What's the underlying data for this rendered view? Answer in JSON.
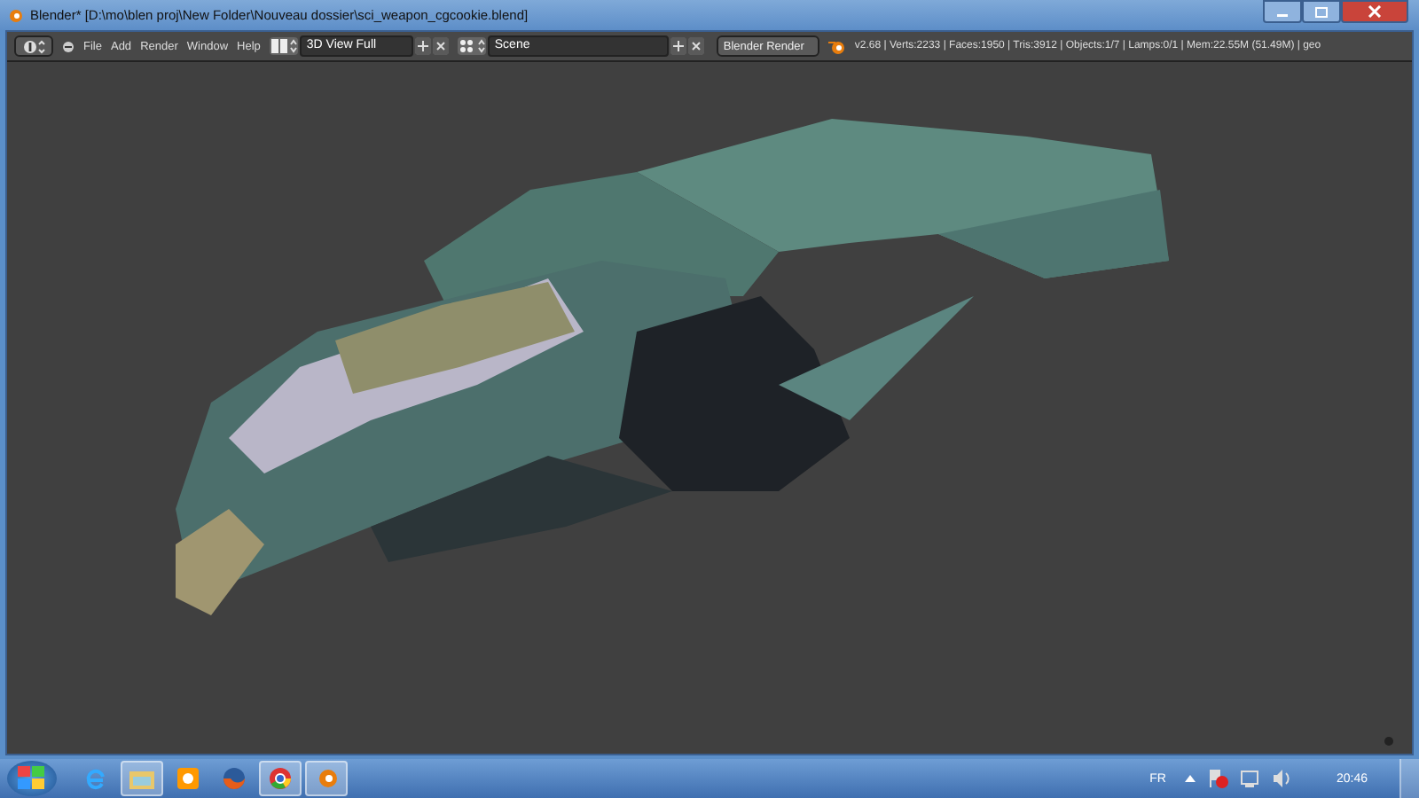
{
  "window": {
    "title": "Blender* [D:\\mo\\blen proj\\New Folder\\Nouveau dossier\\sci_weapon_cgcookie.blend]"
  },
  "header": {
    "menus": [
      "File",
      "Add",
      "Render",
      "Window",
      "Help"
    ],
    "screen_layout": "3D View Full",
    "scene": "Scene",
    "render_engine": "Blender Render",
    "stats": "v2.68 | Verts:2233 | Faces:1950 | Tris:3912 | Objects:1/7 | Lamps:0/1 | Mem:22.55M (51.49M) | geo"
  },
  "taskbar": {
    "apps": [
      {
        "kind": "ie",
        "running": false
      },
      {
        "kind": "explorer",
        "running": true
      },
      {
        "kind": "media",
        "running": false
      },
      {
        "kind": "firefox",
        "running": false
      },
      {
        "kind": "chrome",
        "running": true
      },
      {
        "kind": "blender",
        "running": true
      }
    ],
    "language": "FR",
    "clock": "20:46"
  }
}
